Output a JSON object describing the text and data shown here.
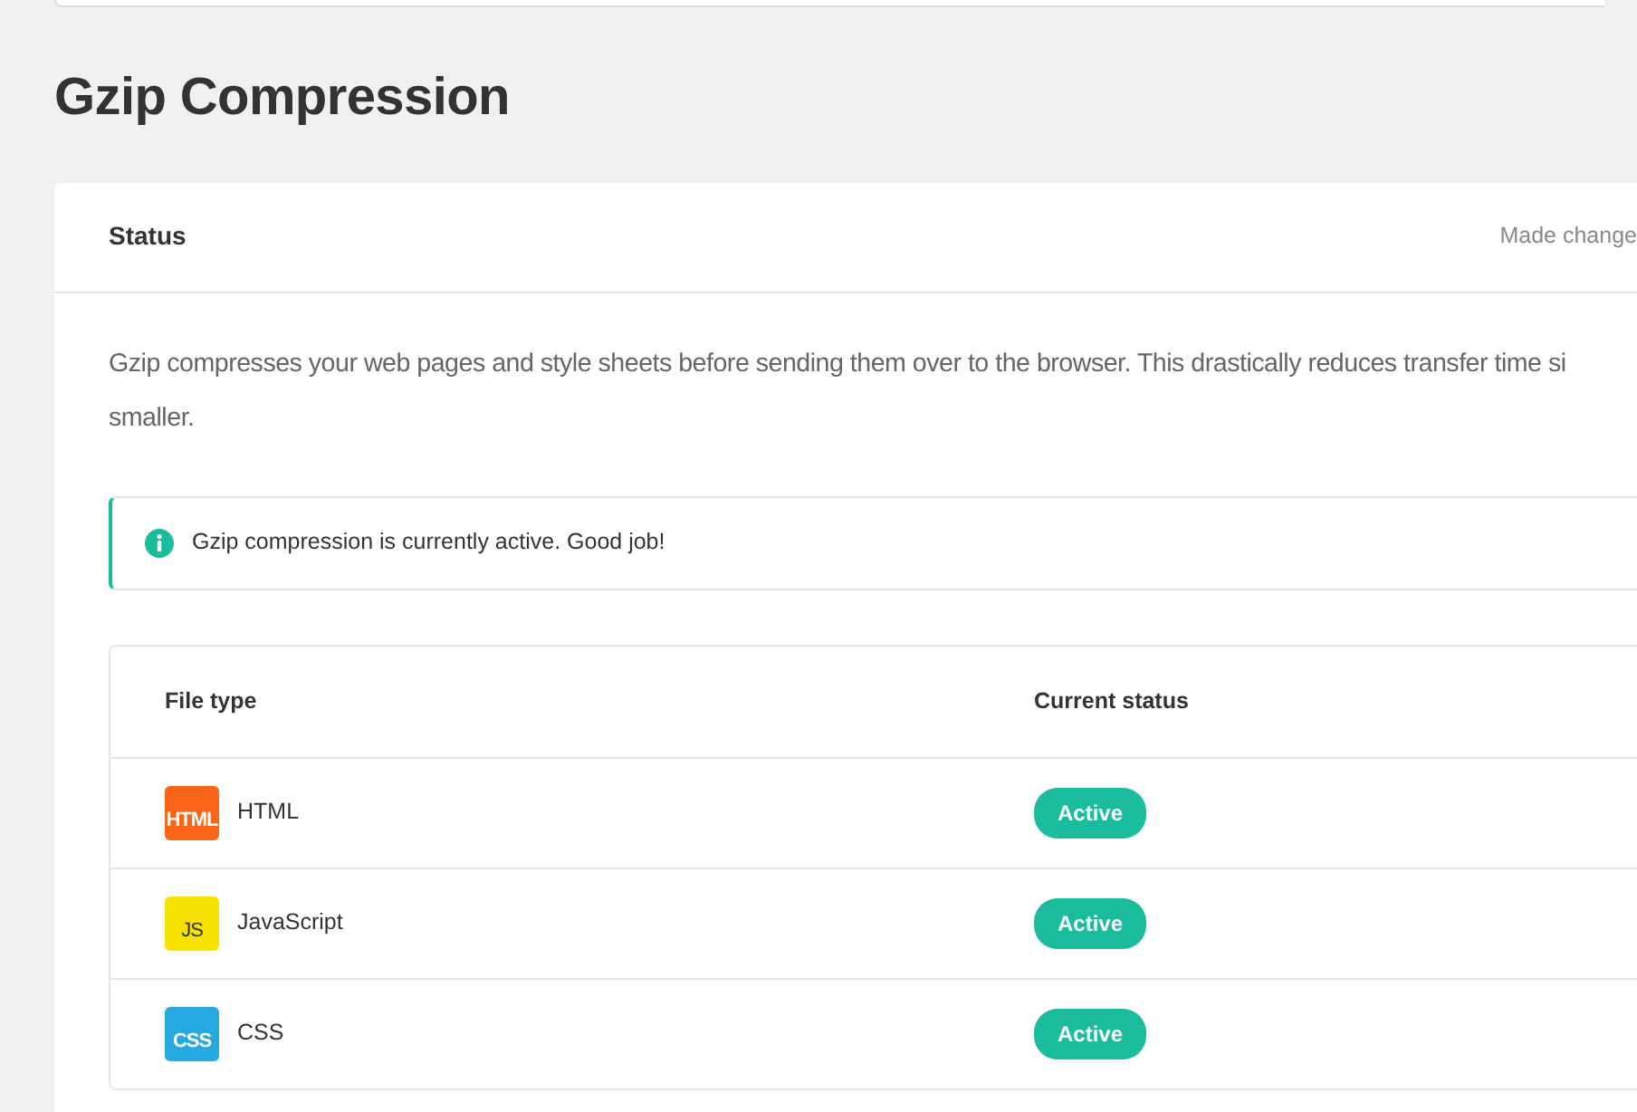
{
  "page_title": "Gzip Compression",
  "status_card": {
    "title": "Status",
    "header_note": "Made change",
    "description": [
      "Gzip compresses your web pages and style sheets before sending them over to the browser. This drastically reduces transfer time si",
      "smaller."
    ],
    "notice": {
      "text": "Gzip compression is currently active. Good job!"
    },
    "table": {
      "columns": [
        "File type",
        "Current status"
      ],
      "rows": [
        {
          "icon_label": "HTML",
          "color": "#f96416",
          "name": "HTML",
          "status": "Active"
        },
        {
          "icon_label": "JS",
          "color": "#f7e100",
          "name": "JavaScript",
          "status": "Active"
        },
        {
          "icon_label": "CSS",
          "color": "#25a9e0",
          "name": "CSS",
          "status": "Active"
        }
      ]
    }
  }
}
